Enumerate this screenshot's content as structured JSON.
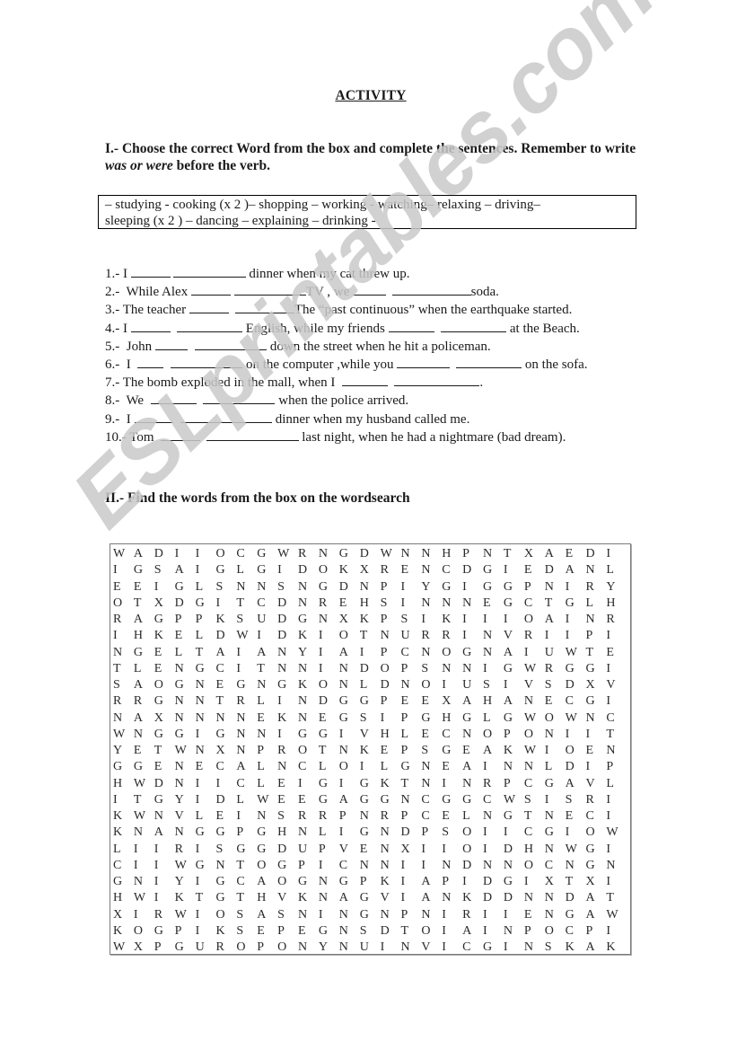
{
  "title": "ACTIVITY",
  "section1": {
    "heading_prefix": "I.-  Choose the correct Word from the box and complete the sentences.  Remember to write ",
    "heading_emphasis": "was or were",
    "heading_suffix": " before the verb."
  },
  "word_box": {
    "line1": "– studying - cooking (x 2 )–  shopping – working - watching– relaxing – driving–",
    "line2": "sleeping (x 2 )  – dancing – explaining – drinking  -"
  },
  "sentences": [
    {
      "number": "1.-",
      "parts": [
        "I ",
        "__6",
        " ",
        "__11",
        " dinner when my cat threw up."
      ]
    },
    {
      "number": "2.-",
      "parts": [
        " While Alex ",
        "__6",
        " ",
        "__11",
        "TV , we ",
        "__5",
        "  ",
        "__12",
        "soda."
      ]
    },
    {
      "number": "3.-",
      "parts": [
        "The teacher ",
        "__6",
        "  ",
        "__9",
        "The “past continuous” when the earthquake started."
      ]
    },
    {
      "number": "4.-",
      "parts": [
        "I ",
        "__6",
        "  ",
        "__10",
        " English, while my friends ",
        "__7",
        "  ",
        "__10",
        " at the Beach."
      ]
    },
    {
      "number": "5.-",
      "parts": [
        " John ",
        "__5",
        "  ",
        "__11",
        " down the street when he hit a policeman."
      ]
    },
    {
      "number": "6.-",
      "parts": [
        " I  ",
        "__4",
        "  ",
        "__11",
        " on the computer ,while you ",
        "__8",
        "  ",
        "__10",
        " on the sofa."
      ]
    },
    {
      "number": "7.-",
      "parts": [
        "The bomb exploded in the mall, when I  ",
        "__7",
        "  ",
        "__13",
        "."
      ]
    },
    {
      "number": "8.-",
      "parts": [
        " We  ",
        "__7",
        "  ",
        "__11",
        " when the police arrived."
      ]
    },
    {
      "number": "9.-",
      "parts": [
        " I ",
        "__6",
        "  ",
        "__14",
        " dinner when my husband called me."
      ]
    },
    {
      "number": "10.-",
      "parts": [
        "Tom  ",
        "__6",
        "  ",
        "__14",
        " last night, when he had a nightmare (bad dream)."
      ]
    }
  ],
  "section2": {
    "heading": "II.-  Find the words from the box on the wordsearch"
  },
  "wordsearch": {
    "rows": [
      "WADIIOCGWRNGDWNNHPNTXAEDI",
      "IGSAIGLGIDOKXRENCDGIEDANL",
      "EEIGLSNNSNGDNPIYGIGGPNIRY",
      "OTXDGITCDNREHSINNNEGCTGLH",
      "RAGPPKSUDGNXKPSIKIIIOAINR",
      "IHKELDWIDKIOTNURRINVRIIPI",
      "NGELTAIANYIAIPCNOGNAIUWTE",
      "TLENGCITNNINDOPSNNIGWRGGI",
      "SAOGNEGNGKONLDNOIUSIVSDXV",
      "RRGNNTRLINDGGPEEXAHANECGI",
      "NAXNNNNEKNEGSIPGHGLGWOWNC",
      "WNGGIGNNIGGIVHLECNOPONIIT",
      "YETWNXNPROTNKEPSGEAKWIOEN",
      "GGENECALNCLOILGNEAINNLDIP",
      "HWDNIICLEIGIGKTNINRPCGAVL",
      "ITGYIDLWEEGAGGNCGGCWSISRI",
      "KWNVLEINSRRPNRPCELNGTNECI",
      "KNANGGPGHNLIGNDPSOIICGIOW",
      "LIIRISGGDUPVENXIIOIDHNWGI",
      "CIIWGNTOGPICNNIINDNNOCNGN",
      "GNIYIGCAOGNGPKIAPIDGIXTXI",
      "HWIKTGTHVKNAGVIANKDDNNDAT",
      "XIRWIOSASNINGNPNIRIIENGAW",
      "KOGPIKSEPEGNSDTOIAINPOCPI",
      "WXPGUROPONYNUINVICGINSKAK"
    ]
  },
  "watermark": {
    "text": "ESLprintables.com",
    "color": "#c9c9c9"
  }
}
